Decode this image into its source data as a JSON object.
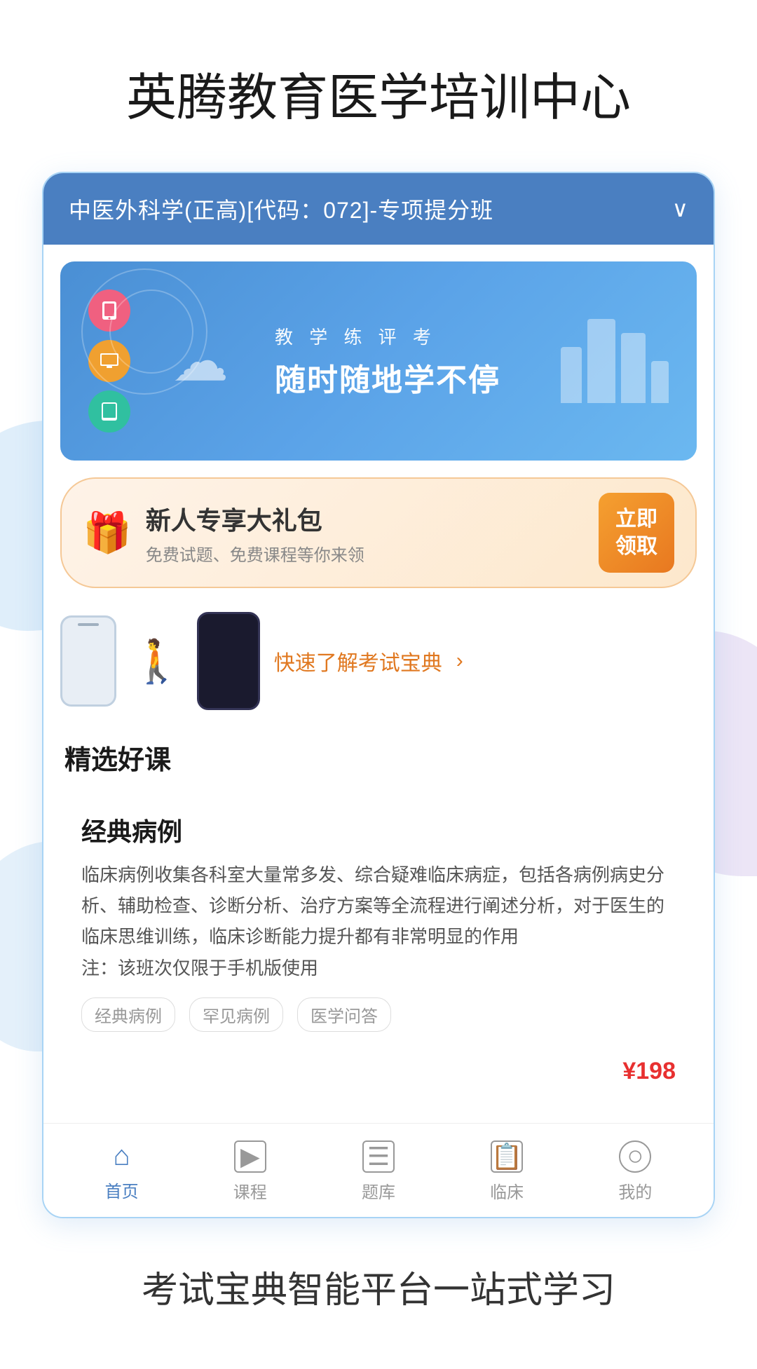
{
  "page": {
    "title": "英腾教育医学培训中心",
    "footer_text": "考试宝典智能平台一站式学习"
  },
  "course_header": {
    "text": "中医外科学(正高)[代码：072]-专项提分班",
    "chevron": "∨"
  },
  "banner": {
    "subtitle": "教 学 练 评 考",
    "title": "随时随地学不停"
  },
  "gift_banner": {
    "title": "新人专享大礼包",
    "subtitle": "免费试题、免费课程等你来领",
    "button_line1": "立即",
    "button_line2": "领取"
  },
  "quick_link": {
    "text": "快速了解考试宝典",
    "arrow": "›"
  },
  "featured_courses": {
    "section_title": "精选好课",
    "course": {
      "title": "经典病例",
      "description": "临床病例收集各科室大量常多发、综合疑难临床病症，包括各病例病史分析、辅助检查、诊断分析、治疗方案等全流程进行阐述分析，对于医生的临床思维训练，临床诊断能力提升都有非常明显的作用\n注：该班次仅限于手机版使用",
      "tags": [
        "经典病例",
        "罕见病例",
        "医学问答"
      ],
      "price": "198",
      "price_symbol": "¥"
    }
  },
  "bottom_nav": {
    "items": [
      {
        "label": "首页",
        "icon": "⌂",
        "active": true
      },
      {
        "label": "课程",
        "icon": "▶",
        "active": false
      },
      {
        "label": "题库",
        "icon": "☰",
        "active": false
      },
      {
        "label": "临床",
        "icon": "📋",
        "active": false
      },
      {
        "label": "我的",
        "icon": "○",
        "active": false
      }
    ]
  },
  "colors": {
    "primary_blue": "#4a7fc1",
    "accent_orange": "#e07820",
    "price_red": "#e83030",
    "text_dark": "#1a1a1a",
    "text_gray": "#555555"
  }
}
